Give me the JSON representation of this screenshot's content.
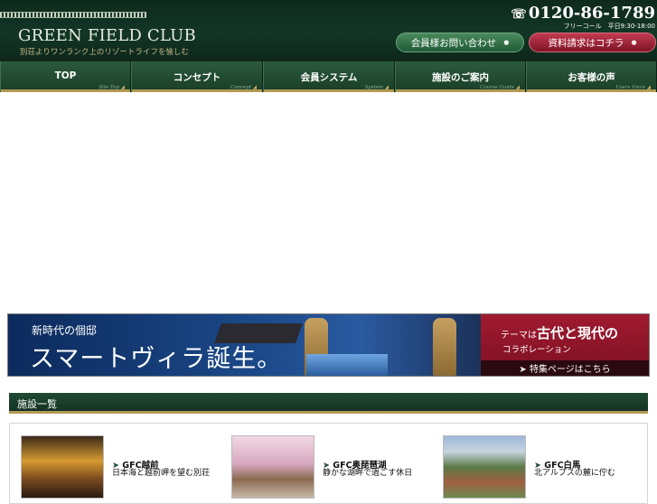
{
  "header": {
    "logo": "GREEN FIELD CLUB",
    "tagline": "別荘よりワンランク上のリゾートライフを愉しむ",
    "phone": "0120-86-1789",
    "phone_note": "フリーコール　平日9:30-18:00",
    "member_button": "会員様お問い合わせ",
    "request_button": "資料請求はコチラ"
  },
  "nav": {
    "items": [
      {
        "label": "TOP",
        "sub": "Site Top"
      },
      {
        "label": "コンセプト",
        "sub": "Concept"
      },
      {
        "label": "会員システム",
        "sub": "System"
      },
      {
        "label": "施設のご案内",
        "sub": "Course Guide"
      },
      {
        "label": "お客様の声",
        "sub": "Users Voice"
      }
    ]
  },
  "banner": {
    "small": "新時代の個邸",
    "big": "スマートヴィラ誕生。",
    "right_pre": "テーマは",
    "right_bold": "古代と現代の",
    "right_line2": "コラボレーション",
    "right_link": "➤ 特集ページはこちら"
  },
  "section": {
    "title": "施設一覧"
  },
  "facilities": [
    {
      "name": "GFC越前",
      "desc": "日本海と越前岬を望む別荘"
    },
    {
      "name": "GFC奥琵琶湖",
      "desc": "静かな湖畔で過ごす休日"
    },
    {
      "name": "GFC白馬",
      "desc": "北アルプスの麓に佇む"
    }
  ]
}
